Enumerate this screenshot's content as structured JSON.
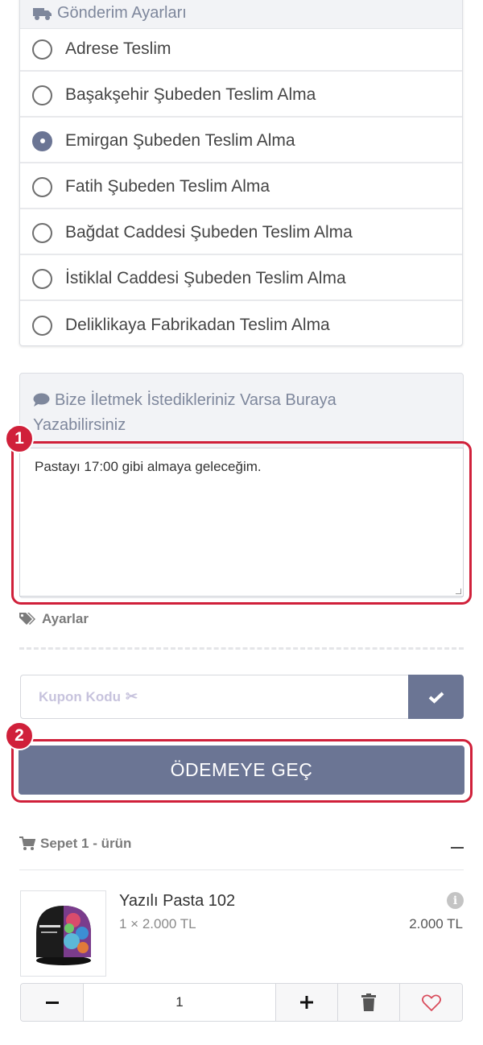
{
  "shipping": {
    "title": "Gönderim Ayarları",
    "options": [
      {
        "label": "Adrese Teslim",
        "selected": false
      },
      {
        "label": "Başakşehir Şubeden Teslim Alma",
        "selected": false
      },
      {
        "label": "Emirgan Şubeden Teslim Alma",
        "selected": true
      },
      {
        "label": "Fatih Şubeden Teslim Alma",
        "selected": false
      },
      {
        "label": "Bağdat Caddesi Şubeden Teslim Alma",
        "selected": false
      },
      {
        "label": "İstiklal Caddesi Şubeden Teslim Alma",
        "selected": false
      },
      {
        "label": "Deliklikaya Fabrikadan Teslim Alma",
        "selected": false
      }
    ]
  },
  "message": {
    "title": "Bize İletmek İstedikleriniz Varsa Buraya Yazabilirsiniz",
    "value": "Pastayı 17:00 gibi almaya geleceğim."
  },
  "annotations": {
    "badge1": "1",
    "badge2": "2",
    "color": "#d0203a"
  },
  "settings": {
    "label": "Ayarlar"
  },
  "coupon": {
    "placeholder": "Kupon Kodu"
  },
  "checkout": {
    "label": "ÖDEMEYE GEÇ"
  },
  "cart": {
    "header": "Sepet 1 - ürün",
    "item": {
      "name": "Yazılı Pasta 102",
      "qty_price": "1 × 2.000 TL",
      "total": "2.000 TL",
      "quantity": "1"
    }
  },
  "colors": {
    "accent": "#6b7594",
    "heading": "#7e879c",
    "panel_bg": "#f2f3f6"
  }
}
